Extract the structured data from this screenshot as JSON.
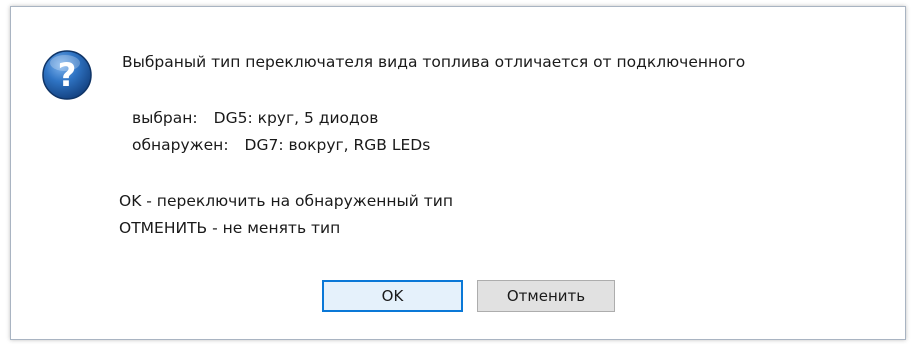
{
  "dialog": {
    "message_main": "Выбраный тип переключателя вида топлива отличается от подключенного",
    "selected_label": "выбран:",
    "selected_value": "DG5: круг, 5 диодов",
    "detected_label": "обнаружен:",
    "detected_value": "DG7: вокруг, RGB LEDs",
    "ok_hint": "OK - переключить на обнаруженный тип",
    "cancel_hint": "ОТМЕНИТЬ - не менять тип",
    "icon": "question-icon"
  },
  "buttons": {
    "ok_label": "OK",
    "cancel_label": "Отменить"
  },
  "colors": {
    "icon_blue": "#1f5fa8",
    "focus_border": "#0a78d7"
  }
}
